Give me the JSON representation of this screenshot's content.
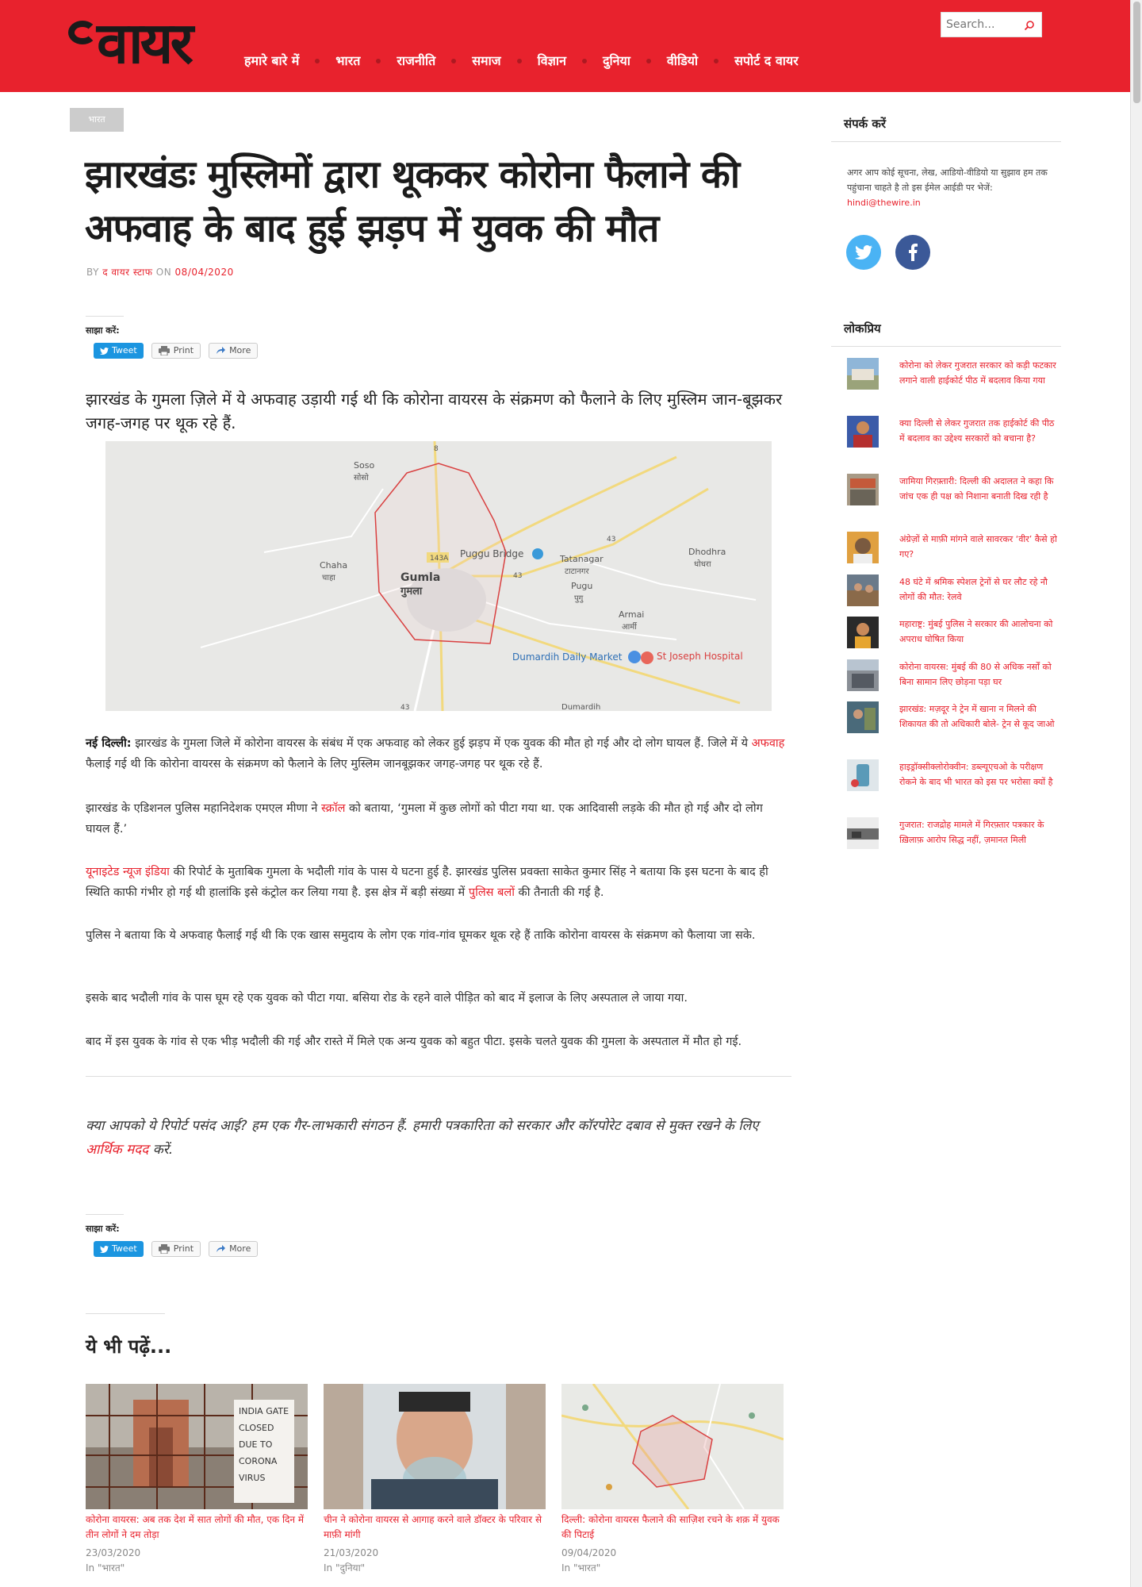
{
  "header": {
    "logo": "वायर",
    "nav": [
      "हमारे बारे में",
      "भारत",
      "राजनीति",
      "समाज",
      "विज्ञान",
      "दुनिया",
      "वीडियो",
      "सपोर्ट द वायर"
    ],
    "search_placeholder": "Search..."
  },
  "article": {
    "category": "भारत",
    "title": "झारखंडः मुस्लिमों द्वारा थूककर कोरोना फैलाने की अफवाह के बाद हुई झड़प में युवक की मौत",
    "by_label": "BY",
    "author": "द वायर स्टाफ",
    "on_label": "ON",
    "date": "08/04/2020",
    "share_label": "साझा करें:",
    "share_tweet": "Tweet",
    "share_print": "Print",
    "share_more": "More",
    "lede": "झारखंड के गुमला ज़िले में ये अफवाह उड़ायी गई थी कि कोरोना वायरस के संक्रमण को फैलाने के लिए मुस्लिम जान-बूझकर जगह-जगह पर थूक रहे हैं.",
    "map": {
      "places": [
        "Soso",
        "सोसो",
        "Chaha",
        "चाहा",
        "Gumla",
        "गुमला",
        "Puggu Bridge",
        "Tatanagar",
        "टाटानगर",
        "Pugu",
        "पुगु",
        "Armai",
        "आर्मी",
        "Dhodhra",
        "धोधरा",
        "Dumardih Daily Market",
        "St Joseph Hospital",
        "Dumardih"
      ],
      "roads": [
        "8",
        "143A",
        "43",
        "43",
        "43"
      ]
    },
    "p1": {
      "lead": "नई दिल्ली:",
      "a": " झारखंड के गुमला जिले में कोरोना वायरस के संबंध में एक अफवाह को लेकर हुई झड़प में एक युवक की मौत हो गई और दो लोग घायल हैं. जिले में ये ",
      "link": "अफवाह",
      "b": " फैलाई गई थी कि कोरोना वायरस के संक्रमण को फैलाने के लिए मुस्लिम जानबूझकर जगह-जगह पर थूक रहे हैं."
    },
    "p2": {
      "a": "झारखंड के एडिशनल पुलिस महानिदेशक एमएल मीणा ने ",
      "link": "स्क्रॉल",
      "b": " को बताया, ‘गुमला में कुछ लोगों को पीटा गया था. एक आदिवासी लड़के की मौत हो गई और दो लोग घायल हैं.’"
    },
    "p3": {
      "link1": "यूनाइटेड न्यूज इंडिया",
      "a": " की रिपोर्ट के मुताबिक गुमला के भदौली गांव के पास ये घटना हुई है. झारखंड पुलिस प्रवक्ता साकेत कुमार सिंह ने बताया कि इस घटना के बाद ही स्थिति काफी गंभीर हो गई थी हालांकि इसे कंट्रोल कर लिया गया है. इस क्षेत्र में बड़ी संख्या में ",
      "link2": "पुलिस बलों",
      "b": " की तैनाती की गई है."
    },
    "p4": "पुलिस ने बताया कि ये अफवाह फैलाई गई थी कि एक खास समुदाय के लोग एक गांव-गांव घूमकर थूक रहे हैं ताकि कोरोना वायरस के संक्रमण को फैलाया जा सके.",
    "p5": "इसके बाद भदौली गांव के पास घूम रहे एक युवक को पीटा गया. बसिया रोड के रहने वाले पीड़ित को बाद में इलाज के लिए अस्पताल ले जाया गया.",
    "p6": "बाद में इस युवक के गांव से एक भीड़ भदौली की गई और रास्ते में मिले एक अन्य युवक को बहुत पीटा. इसके चलते युवक की गुमला के अस्पताल में मौत हो गई.",
    "support": {
      "a": "क्या आपको ये रिपोर्ट पसंद आई? हम एक गैर-लाभकारी संगठन हैं. हमारी पत्रकारिता को सरकार और कॉरपोरेट दबाव से मुक्त रखने के लिए ",
      "link": "आर्थिक मदद",
      "b": " करें."
    }
  },
  "related": {
    "heading": "ये भी पढ़ें...",
    "items": [
      {
        "title": "कोरोना वायरस: अब तक देश में सात लोगों की मौत, एक दिन में तीन लोगों ने दम तोड़ा",
        "date": "23/03/2020",
        "category": "In \"भारत\"",
        "sign": [
          "INDIA GATE",
          "CLOSED",
          "DUE TO",
          "CORONA",
          "VIRUS"
        ]
      },
      {
        "title": "चीन ने कोरोना वायरस से आगाह करने वाले डॉक्टर के परिवार से माफ़ी मांगी",
        "date": "21/03/2020",
        "category": "In \"दुनिया\""
      },
      {
        "title": "दिल्ली: कोरोना वायरस फैलाने की साज़िश रचने के शक़ में युवक की पिटाई",
        "date": "09/04/2020",
        "category": "In \"भारत\""
      }
    ]
  },
  "sidebar": {
    "contact_heading": "संपर्क करें",
    "contact_text": "अगर आप कोई सूचना, लेख, आडियो-वीडियो या सुझाव हम तक पहुंचाना चाहते है तो इस ईमेल आईडी पर भेजें:",
    "contact_email": "hindi@thewire.in",
    "popular_heading": "लोकप्रिय",
    "popular": [
      "कोरोना को लेकर गुजरात सरकार को कड़ी फटकार लगाने वाली हाईकोर्ट पीठ में बदलाव किया गया",
      "क्या दिल्ली से लेकर गुजरात तक हाईकोर्ट की पीठ में बदलाव का उद्देश्य सरकारों को बचाना है?",
      "जामिया गिरफ़्तारी: दिल्ली की अदालत ने कहा कि जांच एक ही पक्ष को निशाना बनाती दिख रही है",
      "अंग्रेज़ों से माफ़ी मांगने वाले सावरकर ‘वीर’ कैसे हो गए?",
      "48 घंटे में श्रमिक स्पेशल ट्रेनों से घर लौट रहे नौ लोगों की मौत: रेलवे",
      "महाराष्ट्र: मुंबई पुलिस ने सरकार की आलोचना को अपराध घोषित किया",
      "कोरोना वायरस: मुंबई की 80 से अधिक नर्सों को बिना सामान लिए छोड़ना पड़ा घर",
      "झारखंड: मज़दूर ने ट्रेन में खाना न मिलने की शिकायत की तो अधिकारी बोले- ट्रेन से कूद जाओ",
      "हाइड्रॉक्सीक्लोरोक्वीन: डब्ल्यूएचओ के परीक्षण रोकने के बाद भी भारत को इस पर भरोसा क्यों है",
      "गुजरात: राजद्रोह मामले में गिरफ़्तार पत्रकार के ख़िलाफ़ आरोप सिद्ध नहीं, ज़मानत मिली"
    ]
  },
  "colors": {
    "brand": "#e8222d",
    "twitter": "#4ab3f4",
    "facebook": "#3b5998"
  }
}
